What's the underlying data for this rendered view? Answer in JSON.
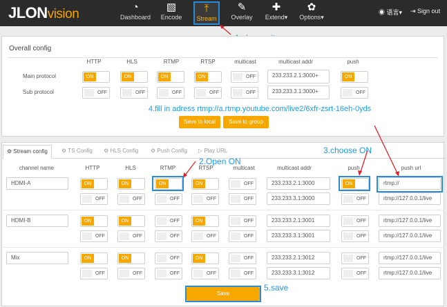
{
  "nav": {
    "logo_a": "JLON",
    "logo_b": "vision",
    "items": [
      {
        "label": "Dashboard",
        "icon": "◔"
      },
      {
        "label": "Encode",
        "icon": "▧"
      },
      {
        "label": "Stream",
        "icon": "⤒"
      },
      {
        "label": "Overlay",
        "icon": "✎"
      },
      {
        "label": "Extend▾",
        "icon": "✚"
      },
      {
        "label": "Options▾",
        "icon": "✿"
      }
    ],
    "language": "◉ 语言▾",
    "signout": "⇥ Sign out"
  },
  "notes": {
    "n1": "1.choose it",
    "n2": "2.Open ON",
    "n3": "3.choose ON",
    "n4": "4.fill in adress  rtmp://a.rtmp.youtube.com/live2/6xfr-zsrt-16eh-0yds",
    "n5": "5.save"
  },
  "overall": {
    "title": "Overall config",
    "headers": [
      "HTTP",
      "HLS",
      "RTMP",
      "RTSP",
      "multicast",
      "multicast addr",
      "push"
    ],
    "rows": [
      {
        "label": "Main protocol",
        "states": [
          "ON",
          "ON",
          "ON",
          "ON",
          "OFF"
        ],
        "addr": "233.233.2.1:3000+",
        "push": "ON"
      },
      {
        "label": "Sub protocol",
        "states": [
          "OFF",
          "OFF",
          "OFF",
          "OFF",
          "OFF"
        ],
        "addr": "233.233.3.1:3000+",
        "push": "OFF"
      }
    ],
    "save_local": "Save to local",
    "save_group": "Save to group"
  },
  "tabs": [
    "Stream config",
    "TS Config",
    "HLS Config",
    "Push Config",
    "Play URL"
  ],
  "tab_icons": [
    "⚙",
    "⚙",
    "⚙",
    "⚙",
    "▷"
  ],
  "stream": {
    "headers": [
      "channel name",
      "HTTP",
      "HLS",
      "RTMP",
      "RTSP",
      "multicast",
      "multicast addr",
      "push",
      "push url"
    ],
    "channels": [
      {
        "name": "HDMI-A",
        "rows": [
          {
            "s": [
              "ON",
              "ON",
              "ON",
              "ON",
              "OFF"
            ],
            "addr": "233.233.2.1:3000",
            "push": "ON",
            "url": "rtmp://"
          },
          {
            "s": [
              "OFF",
              "OFF",
              "OFF",
              "OFF",
              "OFF"
            ],
            "addr": "233.233.3.1:3000",
            "push": "OFF",
            "url": "rtmp://127.0.0.1/live"
          }
        ]
      },
      {
        "name": "HDMI-B",
        "rows": [
          {
            "s": [
              "ON",
              "ON",
              "OFF",
              "ON",
              "OFF"
            ],
            "addr": "233.233.2.1:3001",
            "push": "OFF",
            "url": "rtmp://127.0.0.1/live"
          },
          {
            "s": [
              "OFF",
              "OFF",
              "OFF",
              "OFF",
              "OFF"
            ],
            "addr": "233.233.3.1:3001",
            "push": "OFF",
            "url": "rtmp://127.0.0.1/live"
          }
        ]
      },
      {
        "name": "Mix",
        "rows": [
          {
            "s": [
              "ON",
              "ON",
              "OFF",
              "ON",
              "OFF"
            ],
            "addr": "233.233.2.1:3012",
            "push": "OFF",
            "url": "rtmp://127.0.0.1/live"
          },
          {
            "s": [
              "OFF",
              "OFF",
              "OFF",
              "OFF",
              "OFF"
            ],
            "addr": "233.233.3.1:3012",
            "push": "OFF",
            "url": "rtmp://127.0.0.1/live"
          }
        ]
      }
    ],
    "save": "Save"
  }
}
